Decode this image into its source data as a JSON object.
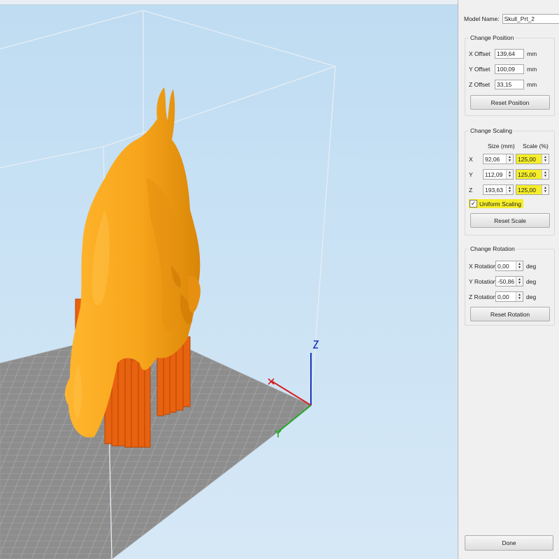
{
  "panel": {
    "model_name_label": "Model Name:",
    "model_name_value": "Skull_Prt_2",
    "position": {
      "title": "Change Position",
      "x_label": "X Offset",
      "x_value": "139,64",
      "y_label": "Y Offset",
      "y_value": "100,09",
      "z_label": "Z Offset",
      "z_value": "33,15",
      "unit": "mm",
      "reset_label": "Reset Position"
    },
    "scaling": {
      "title": "Change Scaling",
      "size_header": "Size (mm)",
      "scale_header": "Scale (%)",
      "x_label": "X",
      "x_size": "92,06",
      "x_scale": "125,00",
      "y_label": "Y",
      "y_size": "112,09",
      "y_scale": "125,00",
      "z_label": "Z",
      "z_size": "193,63",
      "z_scale": "125,00",
      "uniform_label": "Uniform Scaling",
      "uniform_checked": true,
      "reset_label": "Reset Scale"
    },
    "rotation": {
      "title": "Change Rotation",
      "x_label": "X Rotation",
      "x_value": "0,00",
      "y_label": "Y Rotation",
      "y_value": "-50,86",
      "z_label": "Z Rotation",
      "z_value": "0,00",
      "unit": "deg",
      "reset_label": "Reset Rotation"
    },
    "done_label": "Done"
  },
  "viewport": {
    "model_color": "#f7a51b",
    "support_color": "#e8620f",
    "bed_color": "#8a8a8a",
    "highlight_color": "#f6ee2a",
    "axis_x_color": "#d42020",
    "axis_y_color": "#22a822",
    "axis_z_color": "#1a35b8"
  }
}
